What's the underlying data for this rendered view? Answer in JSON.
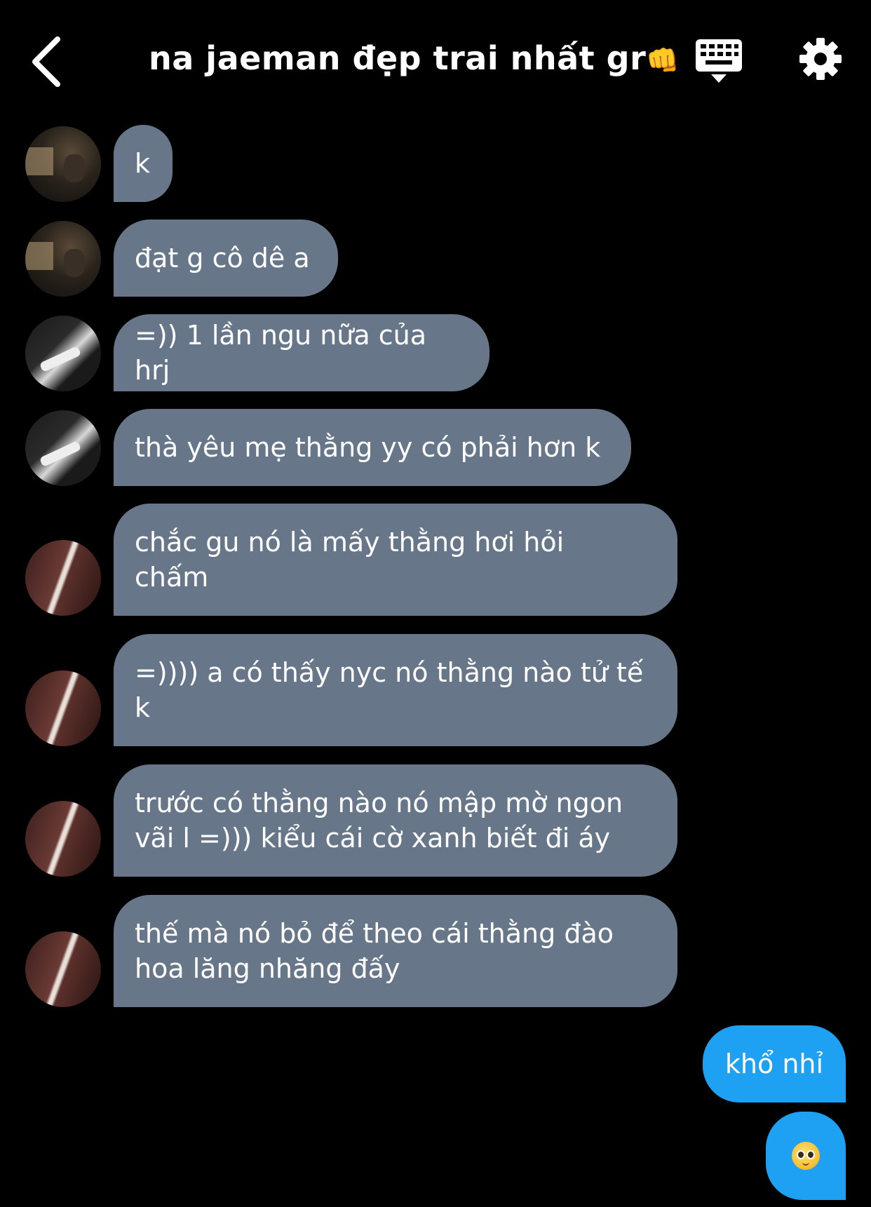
{
  "header": {
    "title": "na jaeman đẹp trai nhất gr",
    "title_emoji": "👊"
  },
  "messages": [
    {
      "text": "k"
    },
    {
      "text": "đạt g cô dê a"
    },
    {
      "text": "=)) 1 lần ngu nữa của hrj"
    },
    {
      "text": "thà yêu mẹ thằng yy có phải hơn k"
    },
    {
      "text": "chắc gu nó là mấy thằng hơi hỏi\nchấm"
    },
    {
      "text": "=)))) a có thấy nyc nó thằng nào tử tế\nk"
    },
    {
      "text": "trước có thằng nào nó mập mờ ngon\nvãi l =))) kiểu cái cờ xanh biết đi áy"
    },
    {
      "text": "thế mà nó bỏ để theo cái thằng đào\nhoa lăng nhăng đấy"
    },
    {
      "text": "khổ nhỉ"
    }
  ],
  "colors": {
    "incoming_bubble": "#677789",
    "outgoing_bubble": "#1ea1f2",
    "background": "#000000"
  },
  "icons": [
    "back-chevron-icon",
    "keyboard-icon",
    "gear-icon",
    "pleading-face-emoji-icon"
  ]
}
